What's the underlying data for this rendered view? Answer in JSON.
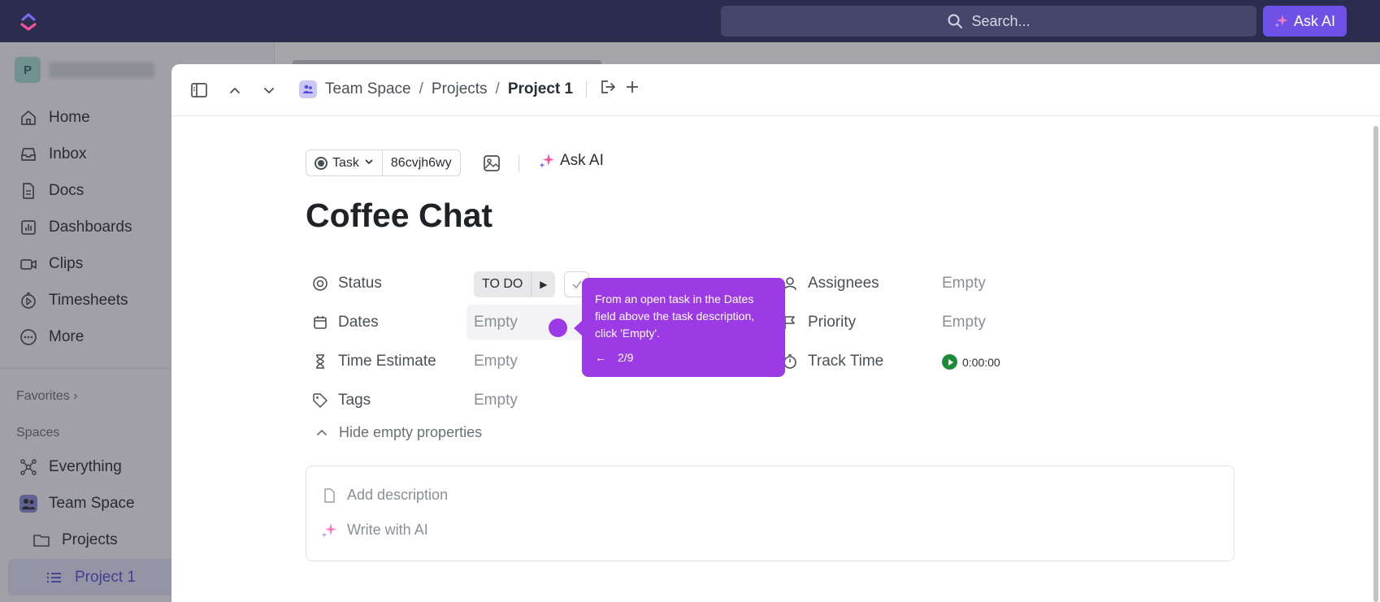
{
  "topbar": {
    "search_placeholder": "Search...",
    "ask_ai": "Ask AI"
  },
  "sidebar": {
    "workspace_initial": "P",
    "nav": [
      {
        "label": "Home",
        "icon": "home-icon"
      },
      {
        "label": "Inbox",
        "icon": "inbox-icon"
      },
      {
        "label": "Docs",
        "icon": "docs-icon"
      },
      {
        "label": "Dashboards",
        "icon": "dashboards-icon"
      },
      {
        "label": "Clips",
        "icon": "clips-icon"
      },
      {
        "label": "Timesheets",
        "icon": "timesheets-icon"
      },
      {
        "label": "More",
        "icon": "more-icon"
      }
    ],
    "favorites_label": "Favorites",
    "spaces_label": "Spaces",
    "spaces": [
      {
        "label": "Everything",
        "icon": "everything-icon"
      },
      {
        "label": "Team Space",
        "icon": "team-space-icon"
      },
      {
        "label": "Projects",
        "icon": "folder-icon"
      },
      {
        "label": "Project 1",
        "icon": "list-icon"
      }
    ]
  },
  "panel": {
    "breadcrumb": {
      "space": "Team Space",
      "sep": "/",
      "folder": "Projects",
      "list": "Project 1"
    },
    "task_type": "Task",
    "task_id": "86cvjh6wy",
    "ask_ai": "Ask AI",
    "title": "Coffee Chat",
    "props_left": [
      {
        "label": "Status",
        "icon": "status-icon"
      },
      {
        "label": "Dates",
        "icon": "calendar-icon",
        "value": "Empty"
      },
      {
        "label": "Time Estimate",
        "icon": "hourglass-icon",
        "value": "Empty"
      },
      {
        "label": "Tags",
        "icon": "tag-icon",
        "value": "Empty"
      }
    ],
    "status_value": "TO DO",
    "props_right": [
      {
        "label": "Assignees",
        "icon": "user-icon",
        "value": "Empty"
      },
      {
        "label": "Priority",
        "icon": "flag-icon",
        "value": "Empty"
      },
      {
        "label": "Track Time",
        "icon": "stopwatch-icon",
        "value": "0:00:00"
      }
    ],
    "hide_empty": "Hide empty properties",
    "add_description": "Add description",
    "write_ai": "Write with AI"
  },
  "tooltip": {
    "text": "From an open task in the Dates field above the task description, click 'Empty'.",
    "back": "←",
    "step": "2/9"
  },
  "colors": {
    "topbar": "#2b2d4f",
    "accent": "#9c3be6",
    "ask_ai_button": "#6e52e8"
  }
}
